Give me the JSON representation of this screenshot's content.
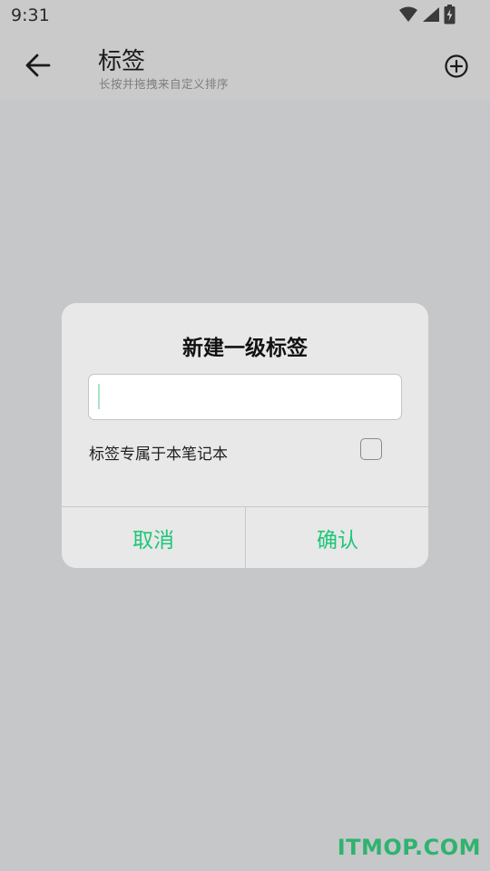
{
  "status_bar": {
    "time": "9:31",
    "icons": [
      "wifi-icon",
      "cell-signal-icon",
      "battery-charging-icon"
    ]
  },
  "app_bar": {
    "title": "标签",
    "subtitle": "长按并拖拽来自定义排序",
    "back_icon": "arrow-left-icon",
    "add_icon": "plus-circle-icon"
  },
  "dialog": {
    "title": "新建一级标签",
    "input": {
      "value": "",
      "placeholder": ""
    },
    "exclusive_label": "标签专属于本笔记本",
    "exclusive_checked": false,
    "cancel_label": "取消",
    "confirm_label": "确认"
  },
  "watermark": "ITMOP.COM",
  "colors": {
    "accent": "#1ec677",
    "dim_background": "#c6c7c9",
    "dialog_background": "#e8e8e8"
  }
}
